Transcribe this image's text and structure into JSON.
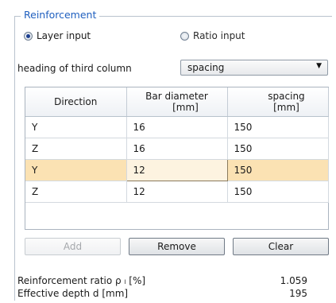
{
  "group": {
    "title": "Reinforcement"
  },
  "input_mode": {
    "options": [
      {
        "label": "Layer input",
        "selected": true
      },
      {
        "label": "Ratio input",
        "selected": false
      }
    ]
  },
  "heading_select": {
    "label": "heading of third column",
    "value": "spacing"
  },
  "table": {
    "columns": [
      {
        "line1": "Direction",
        "line2": ""
      },
      {
        "line1": "Bar diameter",
        "line2": "[mm]"
      },
      {
        "line1": "spacing",
        "line2": "[mm]"
      }
    ],
    "rows": [
      {
        "direction": "Y",
        "diameter": "16",
        "spacing": "150",
        "selected": false
      },
      {
        "direction": "Z",
        "diameter": "16",
        "spacing": "150",
        "selected": false
      },
      {
        "direction": "Y",
        "diameter": "12",
        "spacing": "150",
        "selected": true
      },
      {
        "direction": "Z",
        "diameter": "12",
        "spacing": "150",
        "selected": false
      }
    ]
  },
  "buttons": {
    "add": "Add",
    "remove": "Remove",
    "clear": "Clear"
  },
  "results": {
    "ratio_label": "Reinforcement ratio ρ ₗ [%]",
    "ratio_value": "1.059",
    "depth_label": "Effective depth d  [mm]",
    "depth_value": "195"
  },
  "colors": {
    "title": "#1f5fbf",
    "selected_row": "#fbe2b3"
  }
}
